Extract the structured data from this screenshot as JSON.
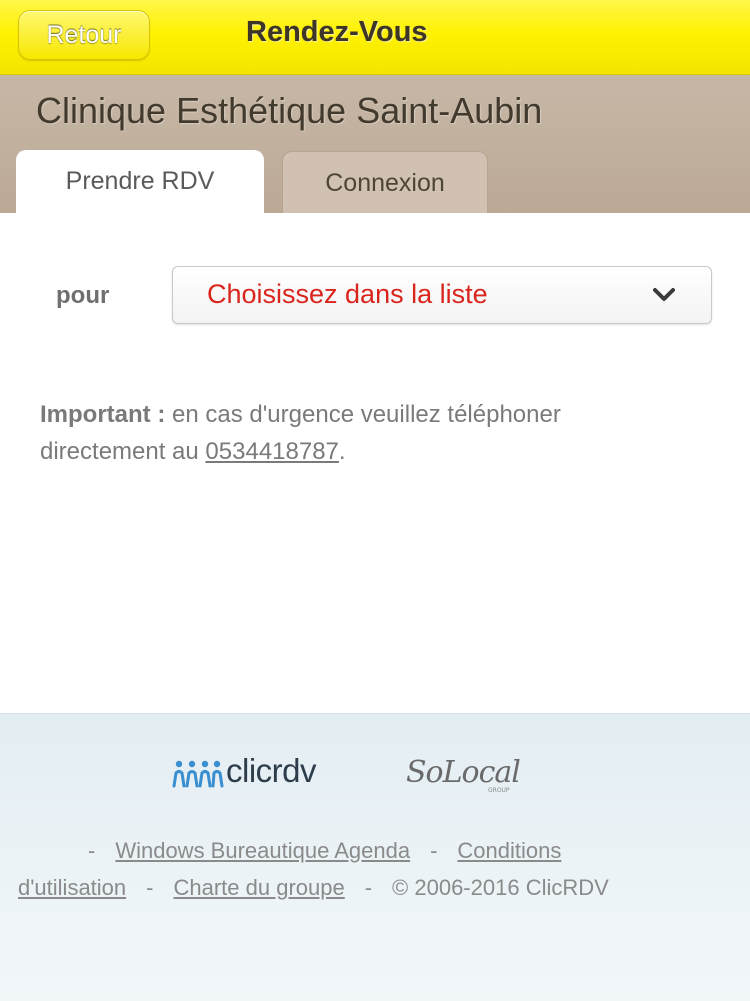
{
  "topbar": {
    "back_label": "Retour",
    "title": "Rendez-Vous"
  },
  "header": {
    "clinic_name": "Clinique Esthétique Saint-Aubin",
    "tabs": [
      {
        "label": "Prendre RDV",
        "active": true
      },
      {
        "label": "Connexion",
        "active": false
      }
    ]
  },
  "form": {
    "pour_label": "pour",
    "select_value": "Choisissez dans la liste"
  },
  "notice": {
    "strong": "Important :",
    "text": " en cas d'urgence veuillez téléphoner directement au ",
    "phone": "0534418787",
    "end": "."
  },
  "footer": {
    "clicrdv_logo_text": "clicrdv",
    "solocal_logo_text": "SoLocal",
    "solocal_sub_text": "GROUP",
    "separator": "-",
    "links": {
      "windows": "Windows Bureautique Agenda",
      "conditions_1": "Conditions",
      "conditions_2": "d'utilisation",
      "charte": "Charte du groupe"
    },
    "copyright": "© 2006-2016 ClicRDV"
  },
  "colors": {
    "topbar": "#fff200",
    "header": "#c0af9b",
    "select_text": "#d9251c",
    "logo_blue": "#3a8fd0",
    "footer_bg": "#e8f1f5"
  },
  "icons": {
    "select": "chevron-down-icon",
    "clicrdv": "people-icon"
  }
}
